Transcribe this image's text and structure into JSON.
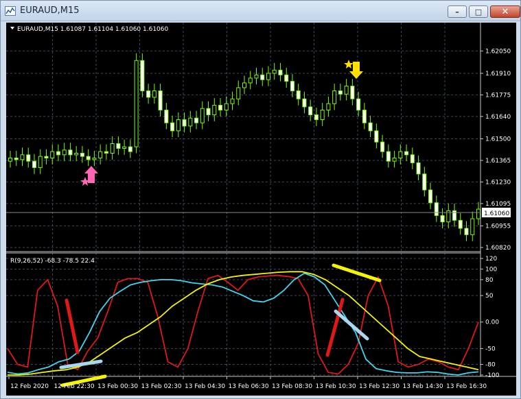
{
  "window": {
    "title": "EURAUD,M15"
  },
  "symbol_header": "EURAUD,M15  1.61087 1.61104 1.61060 1.61060",
  "indicator_header": "R(9,26,52) -68.3 -78.5 22.4",
  "price_axis": {
    "labels": [
      "1.62050",
      "1.61910",
      "1.61775",
      "1.61640",
      "1.61500",
      "1.61365",
      "1.61230",
      "1.61095",
      "1.60955",
      "1.60820"
    ],
    "current_price": "1.61060"
  },
  "indicator_axis": {
    "labels": [
      "120",
      "100",
      "80",
      "50",
      "0.00",
      "-50",
      "-80",
      "-100"
    ]
  },
  "time_axis": {
    "labels": [
      "12 Feb 2020",
      "12 Feb 22:30",
      "13 Feb 00:30",
      "13 Feb 02:30",
      "13 Feb 04:30",
      "13 Feb 06:30",
      "13 Feb 08:30",
      "13 Feb 10:30",
      "13 Feb 12:30",
      "13 Feb 14:30",
      "13 Feb 16:30"
    ]
  },
  "colors": {
    "background": "#000000",
    "candle": "#7cfc00",
    "candle_body": "#ffffff",
    "grid": "#3a4a5a",
    "axis_text": "#ffffff",
    "red_line": "#e01818",
    "cyan_line": "#3fd7f0",
    "yellow_line": "#f5f500",
    "buy_arrow": "#ff66b3",
    "sell_arrow": "#ffe000"
  },
  "chart_data": [
    {
      "type": "candlestick",
      "title": "EURAUD,M15",
      "ylim": [
        1.6082,
        1.6215
      ],
      "close_approx": [
        1.6138,
        1.6137,
        1.614,
        1.6136,
        1.6132,
        1.6139,
        1.6138,
        1.6142,
        1.614,
        1.6143,
        1.614,
        1.6141,
        1.6139,
        1.6137,
        1.6138,
        1.6142,
        1.6141,
        1.6147,
        1.6144,
        1.6145,
        1.6142,
        1.6199,
        1.618,
        1.6176,
        1.618,
        1.6168,
        1.616,
        1.6155,
        1.6162,
        1.6158,
        1.6163,
        1.616,
        1.6169,
        1.6165,
        1.6171,
        1.6168,
        1.6172,
        1.6175,
        1.6182,
        1.6185,
        1.6188,
        1.619,
        1.6187,
        1.6191,
        1.6193,
        1.619,
        1.6186,
        1.618,
        1.6175,
        1.617,
        1.6165,
        1.6162,
        1.6168,
        1.6172,
        1.618,
        1.6178,
        1.6183,
        1.6175,
        1.6168,
        1.616,
        1.6155,
        1.6148,
        1.6142,
        1.6136,
        1.6138,
        1.6142,
        1.614,
        1.6135,
        1.6128,
        1.6118,
        1.611,
        1.6102,
        1.6098,
        1.6105,
        1.6099,
        1.6094,
        1.609,
        1.61,
        1.6106
      ]
    },
    {
      "type": "line",
      "title": "R(9,26,52)",
      "ylim": [
        -100,
        120
      ],
      "series": [
        {
          "name": "",
          "color": "red",
          "values": [
            -50,
            -80,
            -85,
            60,
            80,
            30,
            -80,
            -90,
            -55,
            -30,
            20,
            75,
            82,
            82,
            75,
            10,
            -75,
            -85,
            -50,
            20,
            82,
            88,
            75,
            60,
            80,
            85,
            87,
            88,
            86,
            82,
            50,
            -60,
            -95,
            -98,
            -80,
            -40,
            50,
            85,
            30,
            -75,
            -85,
            -80,
            -70,
            -75,
            -85,
            -90,
            -50,
            0
          ]
        },
        {
          "name": "",
          "color": "cyan",
          "values": [
            -95,
            -98,
            -96,
            -90,
            -85,
            -75,
            -70,
            -55,
            -20,
            20,
            45,
            58,
            70,
            75,
            78,
            80,
            80,
            78,
            74,
            72,
            70,
            66,
            58,
            50,
            40,
            38,
            45,
            60,
            80,
            92,
            85,
            70,
            40,
            10,
            -20,
            -70,
            -88,
            -92,
            -95,
            -96,
            -96,
            -94,
            -95,
            -98,
            -100,
            -96,
            -94
          ]
        },
        {
          "name": "",
          "color": "yellow",
          "values": [
            -100,
            -100,
            -98,
            -95,
            -92,
            -90,
            -85,
            -75,
            -60,
            -45,
            -30,
            -20,
            -5,
            10,
            30,
            45,
            60,
            72,
            80,
            85,
            88,
            90,
            92,
            94,
            95,
            95,
            90,
            80,
            65,
            50,
            30,
            10,
            -10,
            -30,
            -50,
            -65,
            -70,
            -75,
            -80,
            -85,
            -90
          ]
        }
      ]
    }
  ]
}
